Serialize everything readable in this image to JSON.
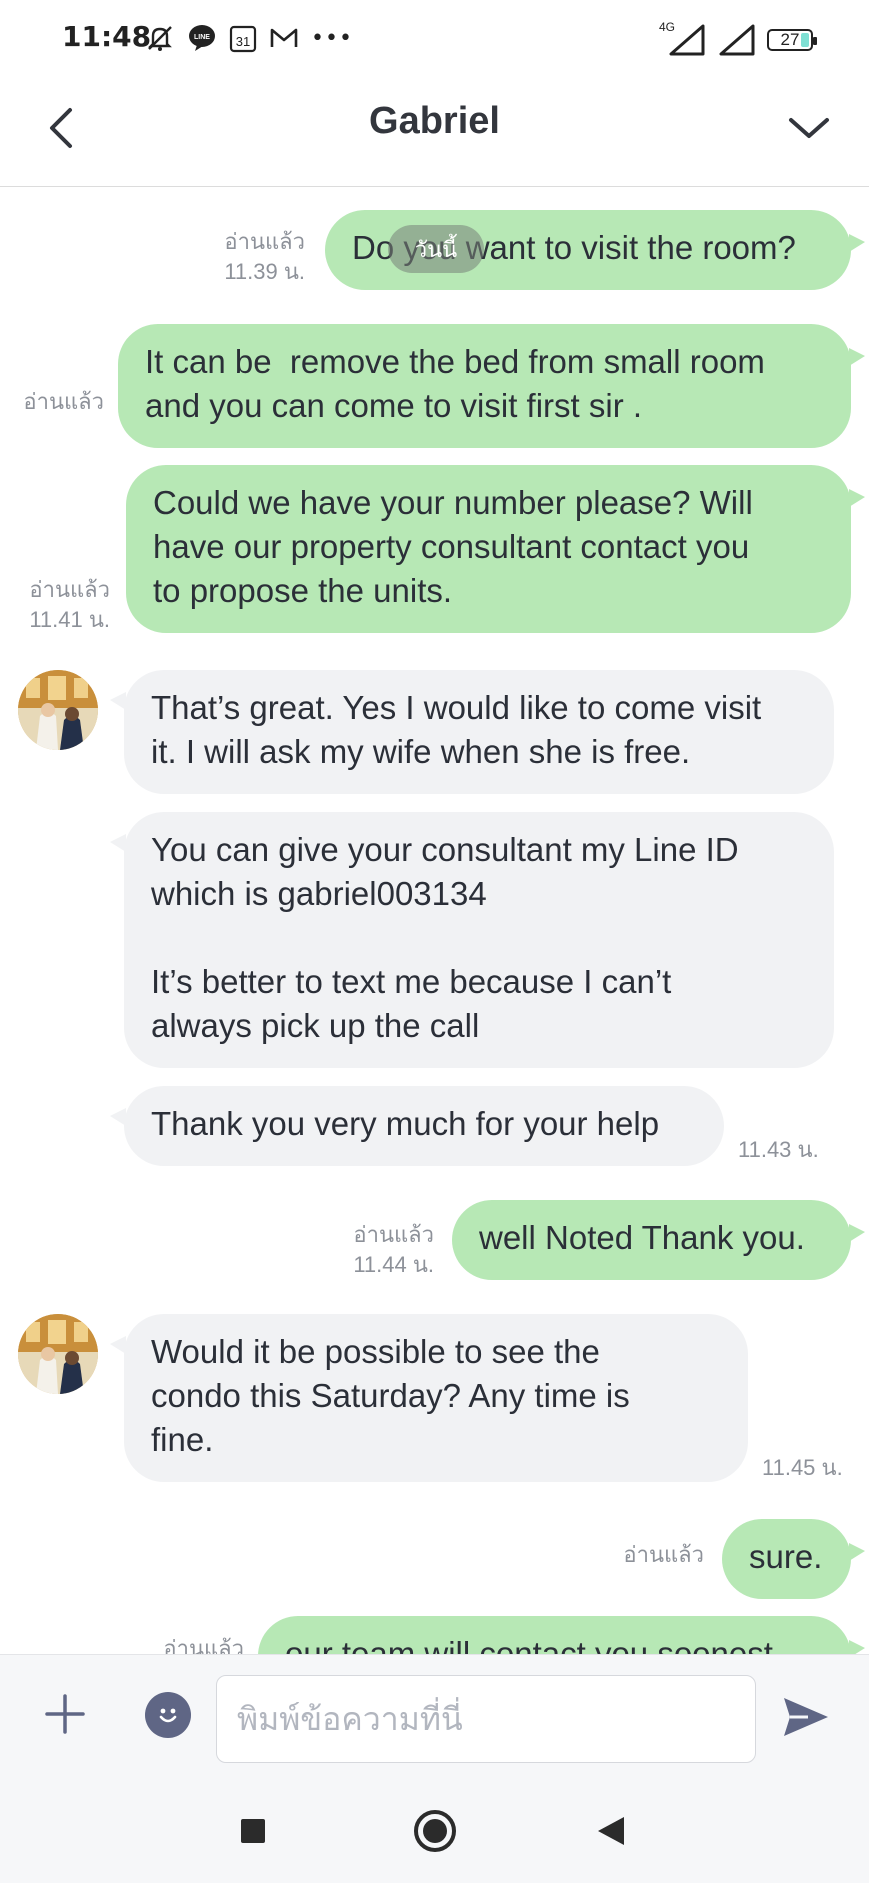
{
  "status_bar": {
    "time": "11:48",
    "calendar_day": "31",
    "more": "•••",
    "network": "4G",
    "battery": "27"
  },
  "header": {
    "title": "Gabriel"
  },
  "date_pill": "วันนี้",
  "messages": [
    {
      "direction": "out",
      "text": "Do you want to visit the room?",
      "read": "อ่านแล้ว",
      "time": "11.39 น."
    },
    {
      "direction": "out",
      "text": "It can be  remove the bed from small room\nand you can come to visit first sir .",
      "read": "อ่านแล้ว",
      "time": ""
    },
    {
      "direction": "out",
      "text": "Could we have your number please? Will\nhave our property consultant contact you\nto propose the units.",
      "read": "อ่านแล้ว",
      "time": "11.41 น."
    },
    {
      "direction": "in",
      "text": "That’s great. Yes I would like to come visit\nit. I will ask my wife when she is free.",
      "time": ""
    },
    {
      "direction": "in",
      "text": "You can give your consultant my Line ID\nwhich is gabriel003134\n\nIt’s better to text me because I can’t\nalways pick up the call",
      "time": ""
    },
    {
      "direction": "in",
      "text": "Thank you very much for your help",
      "time": "11.43 น."
    },
    {
      "direction": "out",
      "text": "well Noted Thank you.",
      "read": "อ่านแล้ว",
      "time": "11.44 น."
    },
    {
      "direction": "in",
      "text": "Would it be possible to see the\ncondo this Saturday? Any time is\nfine.",
      "time": "11.45 น."
    },
    {
      "direction": "out",
      "text": "sure.",
      "read": "อ่านแล้ว",
      "time": ""
    },
    {
      "direction": "out",
      "text": "our team will contact you soonest",
      "read": "อ่านแล้ว",
      "time": ""
    }
  ],
  "input": {
    "placeholder": "พิมพ์ข้อความที่นี่"
  },
  "colors": {
    "outgoing_bubble": "#b7e8b5",
    "incoming_bubble": "#f1f2f4",
    "send_icon": "#5f6685"
  }
}
